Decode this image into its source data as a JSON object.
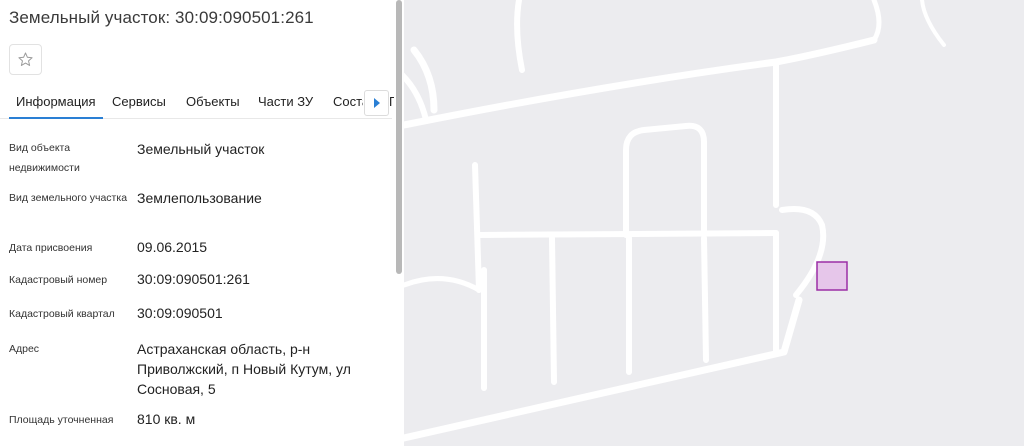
{
  "title": "Земельный участок: 30:09:090501:261",
  "tabs": {
    "info": "Информация",
    "services": "Сервисы",
    "objects": "Объекты",
    "parts": "Части ЗУ",
    "composition_partial": "Соста",
    "next_partial": "П"
  },
  "fields": [
    {
      "label": "Вид объекта недвижимости",
      "value": "Земельный участок"
    },
    {
      "label": "Вид земельного участка",
      "value": "Землепользование"
    },
    {
      "label": "Дата присвоения",
      "value": "09.06.2015"
    },
    {
      "label": "Кадастровый номер",
      "value": "30:09:090501:261"
    },
    {
      "label": "Кадастровый квартал",
      "value": "30:09:090501"
    },
    {
      "label": "Адрес",
      "value": "Астраханская область, р-н Приволжский, п Новый Кутум, ул Сосновая, 5"
    },
    {
      "label": "Площадь уточненная",
      "value": "810 кв. м"
    }
  ],
  "colors": {
    "accent": "#2a7fd4",
    "map_background": "#ececef",
    "roads": "#ffffff",
    "parcel_outline": "#9b2fa6",
    "parcel_fill": "#e6c6ea"
  },
  "icons": {
    "favorite": "star-outline-icon",
    "tabs_scroll": "caret-right-icon"
  }
}
